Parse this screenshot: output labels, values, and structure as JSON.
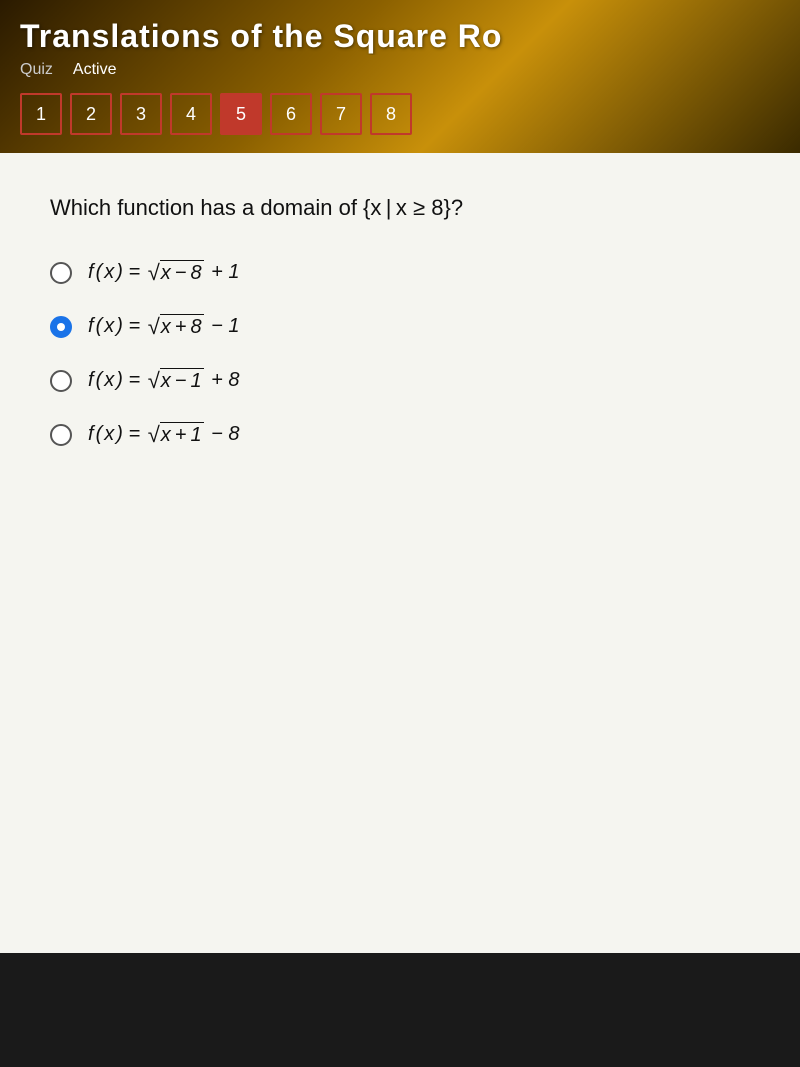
{
  "header": {
    "title": "Translations of the Square Ro",
    "quiz_label": "Quiz",
    "active_label": "Active"
  },
  "nav": {
    "buttons": [
      {
        "number": "1",
        "active": false
      },
      {
        "number": "2",
        "active": false
      },
      {
        "number": "3",
        "active": false
      },
      {
        "number": "4",
        "active": false
      },
      {
        "number": "5",
        "active": true
      },
      {
        "number": "6",
        "active": false
      },
      {
        "number": "7",
        "active": false
      },
      {
        "number": "8",
        "active": false
      }
    ]
  },
  "question": {
    "text": "Which function has a domain of {x | x ≥ 8}?",
    "options": [
      {
        "id": "a",
        "label": "f(x) = √(x−8) + 1",
        "selected": false
      },
      {
        "id": "b",
        "label": "f(x) = √(x+8) − 1",
        "selected": true
      },
      {
        "id": "c",
        "label": "f(x) = √(x−1) + 8",
        "selected": false
      },
      {
        "id": "d",
        "label": "f(x) = √(x+1) − 8",
        "selected": false
      }
    ]
  }
}
